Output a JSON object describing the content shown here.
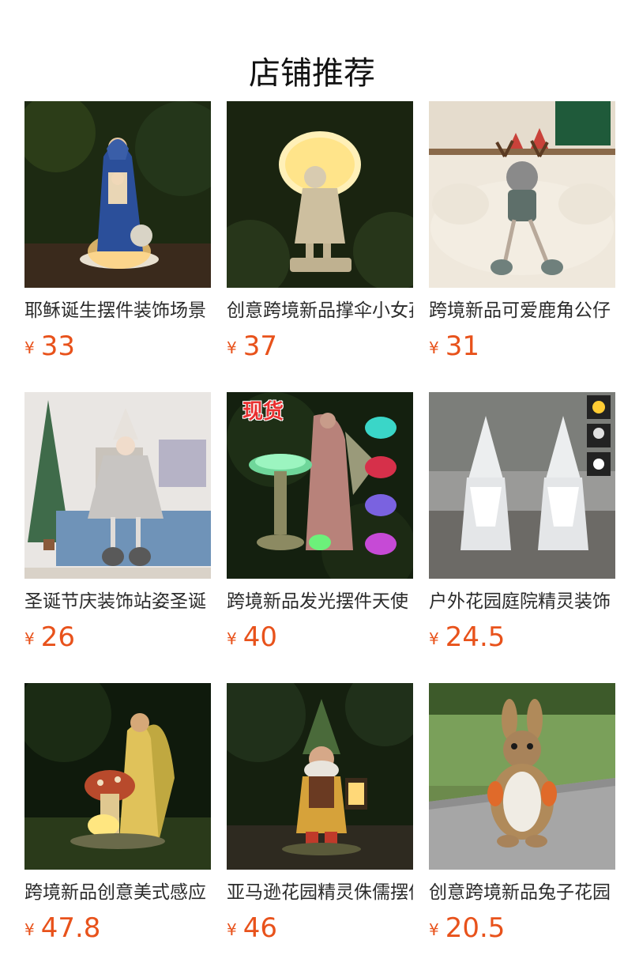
{
  "page": {
    "title": "店铺推荐"
  },
  "products": [
    {
      "name": "耶稣诞生摆件装饰场景",
      "currency": "¥",
      "price": "33",
      "image_icon": "nativity-statue-image"
    },
    {
      "name": "创意跨境新品撑伞小女孩",
      "currency": "¥",
      "price": "37",
      "image_icon": "umbrella-girl-statue-image"
    },
    {
      "name": "跨境新品可爱鹿角公仔",
      "currency": "¥",
      "price": "31",
      "image_icon": "antler-doll-image"
    },
    {
      "name": "圣诞节庆装饰站姿圣诞",
      "currency": "¥",
      "price": "26",
      "image_icon": "christmas-doll-image"
    },
    {
      "name": "跨境新品发光摆件天使",
      "currency": "¥",
      "price": "40",
      "image_icon": "glowing-angel-fountain-image",
      "badge": "现货"
    },
    {
      "name": "户外花园庭院精灵装饰",
      "currency": "¥",
      "price": "24.5",
      "image_icon": "white-gnome-statues-image"
    },
    {
      "name": "跨境新品创意美式感应",
      "currency": "¥",
      "price": "47.8",
      "image_icon": "angel-mushroom-light-image"
    },
    {
      "name": "亚马逊花园精灵侏儒摆件",
      "currency": "¥",
      "price": "46",
      "image_icon": "garden-gnome-lantern-image"
    },
    {
      "name": "创意跨境新品兔子花园",
      "currency": "¥",
      "price": "20.5",
      "image_icon": "rabbit-statue-image"
    }
  ],
  "colors": {
    "price": "#e8521b",
    "title": "#111111"
  }
}
